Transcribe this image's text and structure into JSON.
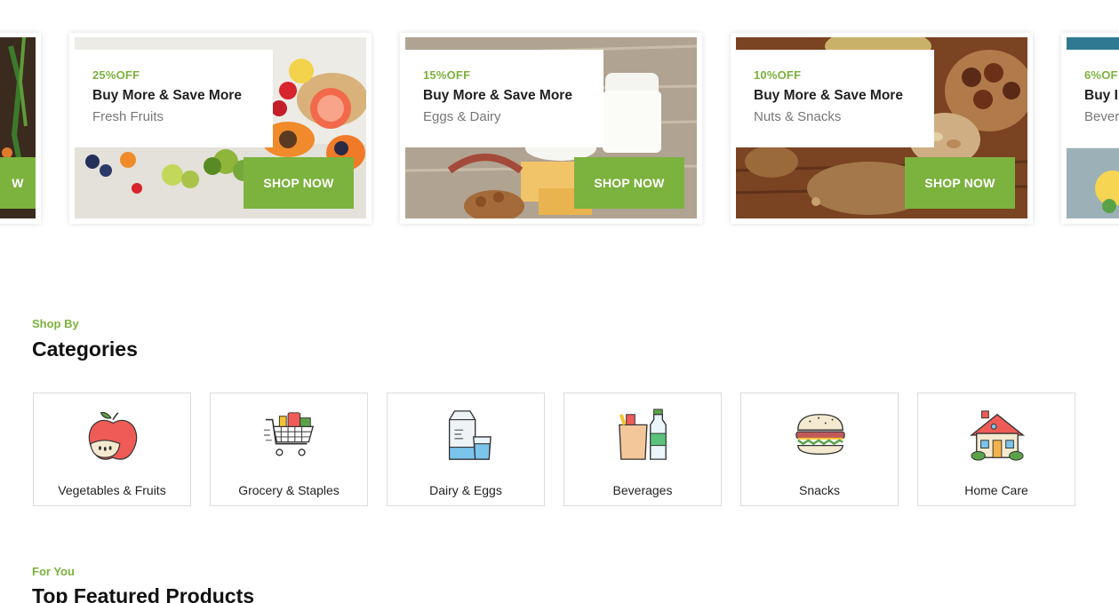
{
  "promos": [
    {
      "off": "",
      "title": "",
      "subtitle": "",
      "button": "W"
    },
    {
      "off": "25%OFF",
      "title": "Buy More & Save More",
      "subtitle": "Fresh Fruits",
      "button": "SHOP NOW"
    },
    {
      "off": "15%OFF",
      "title": "Buy More & Save More",
      "subtitle": "Eggs & Dairy",
      "button": "SHOP NOW"
    },
    {
      "off": "10%OFF",
      "title": "Buy More & Save More",
      "subtitle": "Nuts & Snacks",
      "button": "SHOP NOW"
    },
    {
      "off": "6%OF",
      "title": "Buy I",
      "subtitle": "Bever",
      "button": ""
    }
  ],
  "categories_section": {
    "kicker": "Shop By",
    "title": "Categories",
    "items": [
      {
        "label": "Vegetables & Fruits",
        "icon": "apple-icon"
      },
      {
        "label": "Grocery & Staples",
        "icon": "shopping-cart-icon"
      },
      {
        "label": "Dairy & Eggs",
        "icon": "milk-carton-icon"
      },
      {
        "label": "Beverages",
        "icon": "beverage-bottle-icon"
      },
      {
        "label": "Snacks",
        "icon": "burger-icon"
      },
      {
        "label": "Home Care",
        "icon": "house-icon"
      }
    ]
  },
  "featured_section": {
    "kicker": "For You",
    "title": "Top Featured Products"
  },
  "colors": {
    "accent": "#7cb23e",
    "text": "#1f1f1f",
    "muted": "#777777",
    "border": "#dcdcdc"
  }
}
